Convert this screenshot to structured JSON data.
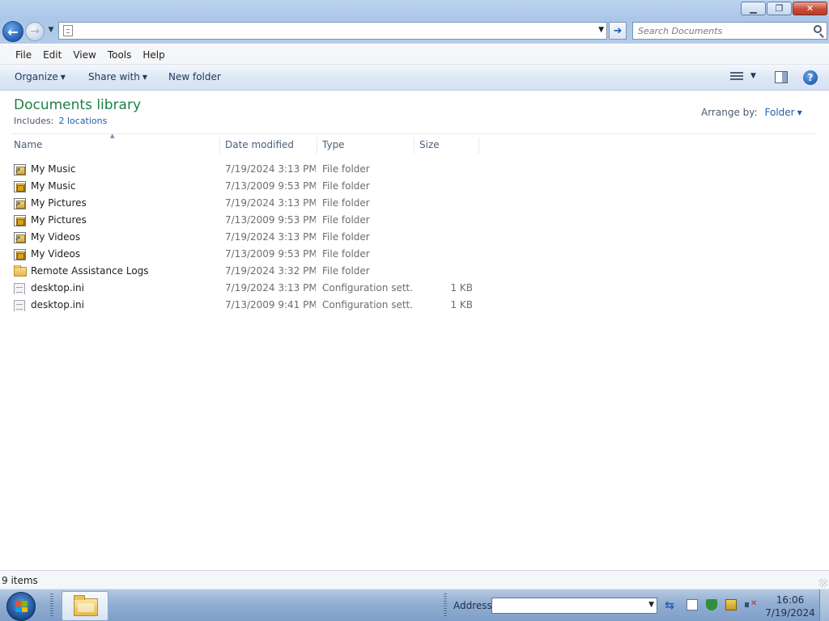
{
  "window": {
    "minimize_glyph": "▁",
    "maximize_glyph": "❐",
    "close_glyph": "✕"
  },
  "nav": {
    "back_glyph": "←",
    "forward_glyph": "→",
    "address_value": "",
    "go_glyph": "➜",
    "search_placeholder": "Search Documents"
  },
  "menu": {
    "items": [
      "File",
      "Edit",
      "View",
      "Tools",
      "Help"
    ]
  },
  "commands": {
    "organize": "Organize",
    "share_with": "Share with",
    "new_folder": "New folder",
    "help_glyph": "?"
  },
  "library": {
    "title": "Documents library",
    "includes_label": "Includes:",
    "locations_link": "2 locations",
    "arrange_label": "Arrange by:",
    "arrange_value": "Folder"
  },
  "columns": {
    "name": "Name",
    "date": "Date modified",
    "type": "Type",
    "size": "Size"
  },
  "files": [
    {
      "name": "My Music",
      "date": "7/19/2024 3:13 PM",
      "type": "File folder",
      "size": "",
      "icon": "shortcut-folder-icon"
    },
    {
      "name": "My Music",
      "date": "7/13/2009 9:53 PM",
      "type": "File folder",
      "size": "",
      "icon": "locked-folder-icon"
    },
    {
      "name": "My Pictures",
      "date": "7/19/2024 3:13 PM",
      "type": "File folder",
      "size": "",
      "icon": "shortcut-folder-icon"
    },
    {
      "name": "My Pictures",
      "date": "7/13/2009 9:53 PM",
      "type": "File folder",
      "size": "",
      "icon": "locked-folder-icon"
    },
    {
      "name": "My Videos",
      "date": "7/19/2024 3:13 PM",
      "type": "File folder",
      "size": "",
      "icon": "shortcut-folder-icon"
    },
    {
      "name": "My Videos",
      "date": "7/13/2009 9:53 PM",
      "type": "File folder",
      "size": "",
      "icon": "locked-folder-icon"
    },
    {
      "name": "Remote Assistance Logs",
      "date": "7/19/2024 3:32 PM",
      "type": "File folder",
      "size": "",
      "icon": "folder-icon"
    },
    {
      "name": "desktop.ini",
      "date": "7/19/2024 3:13 PM",
      "type": "Configuration sett...",
      "size": "1 KB",
      "icon": "ini-file-icon"
    },
    {
      "name": "desktop.ini",
      "date": "7/13/2009 9:41 PM",
      "type": "Configuration sett...",
      "size": "1 KB",
      "icon": "ini-file-icon"
    }
  ],
  "status": {
    "item_count": "9 items"
  },
  "taskbar": {
    "address_label": "Address",
    "address_value": "",
    "time": "16:06",
    "date": "7/19/2024"
  },
  "colors": {
    "library_title": "#1e7f47",
    "link": "#1f5fae",
    "flag": [
      "#f25022",
      "#7fba00",
      "#00a4ef",
      "#ffb900"
    ]
  }
}
